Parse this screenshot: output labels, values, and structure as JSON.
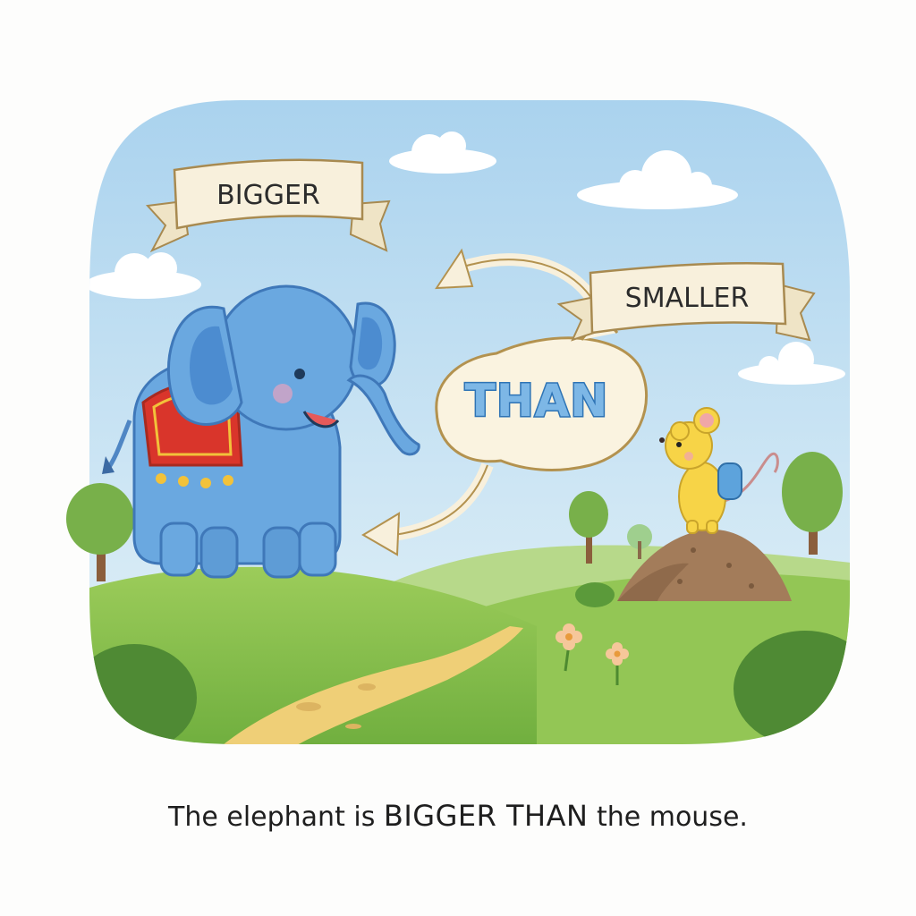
{
  "labels": {
    "bigger": "BIGGER",
    "smaller": "SMALLER",
    "than": "THAN"
  },
  "caption": {
    "part1": "The elephant is ",
    "emphasis": "BIGGER THAN",
    "part2": " the mouse."
  },
  "colors": {
    "sky": "#c9e3f2",
    "grass": "#8cc152",
    "path": "#f0d27a",
    "elephant": "#6aa8e0",
    "blanket": "#d9352b",
    "mouse": "#f7d447",
    "ribbon": "#f8f0dc",
    "than_fill": "#7db7e6"
  }
}
